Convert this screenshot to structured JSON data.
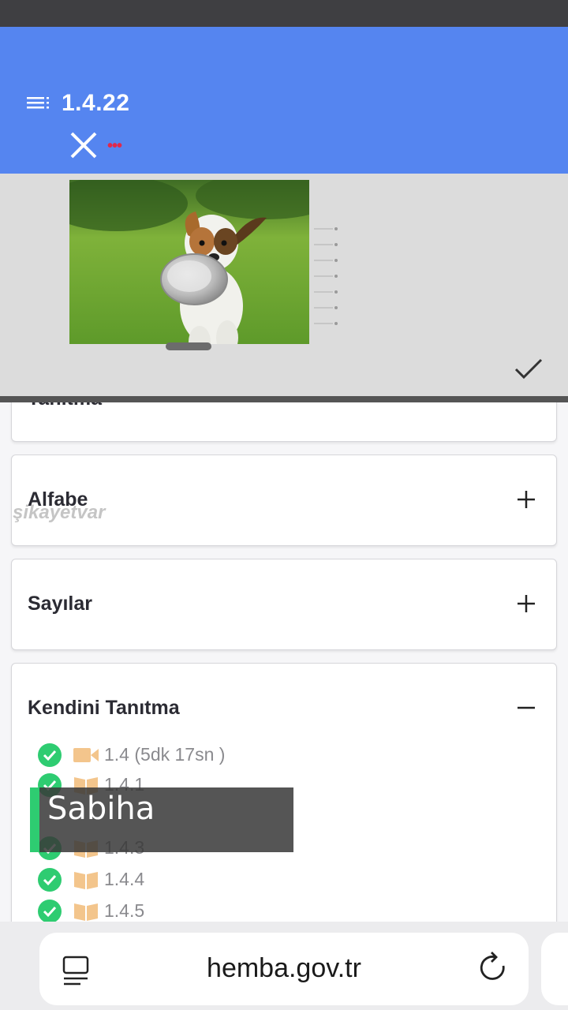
{
  "header": {
    "version": "1.4.22",
    "dots": "•••"
  },
  "cards": [
    {
      "title": "Tanıtma",
      "toggle": "+"
    },
    {
      "title": "Alfabe",
      "toggle": "+"
    },
    {
      "title": "Sayılar",
      "toggle": "+"
    },
    {
      "title": "Kendini Tanıtma",
      "toggle": "−"
    }
  ],
  "lessons": [
    {
      "label": "1.4 (5dk 17sn )",
      "type": "video",
      "done": true
    },
    {
      "label": "1.4.1",
      "type": "book",
      "done": true
    },
    {
      "label": "1.4.3",
      "type": "book",
      "done": true
    },
    {
      "label": "1.4.4",
      "type": "book",
      "done": true
    },
    {
      "label": "1.4.5",
      "type": "book",
      "done": true
    }
  ],
  "watermark": "şikayetvar",
  "caption": "Sabiha",
  "browser": {
    "url": "hemba.gov.tr"
  },
  "colors": {
    "header": "#5585f0",
    "check": "#2ecc71",
    "book": "#f3c58c"
  }
}
